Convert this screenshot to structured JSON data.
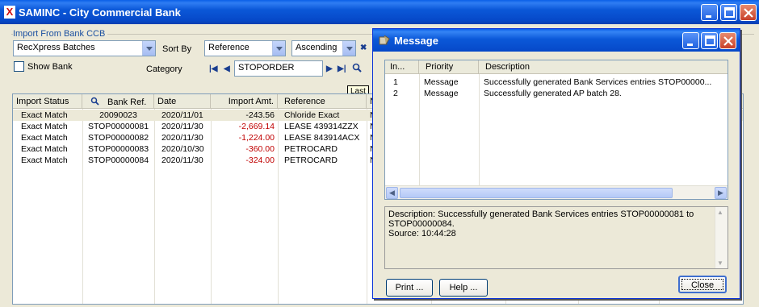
{
  "window": {
    "title": "SAMINC - City Commercial Bank"
  },
  "import_group": {
    "label": "Import From Bank CCB"
  },
  "source_combo": {
    "value": "RecXpress Batches"
  },
  "show_bank": {
    "label": "Show Bank"
  },
  "sort_by": {
    "label": "Sort By",
    "field": "Reference",
    "order": "Ascending"
  },
  "category": {
    "label": "Category",
    "value": "STOPORDER"
  },
  "tooltip": {
    "text": "Last"
  },
  "grid": {
    "columns": [
      "Import Status",
      "Bank Ref.",
      "Date",
      "Import Amt.",
      "Reference",
      "N"
    ],
    "rows": [
      {
        "status": "Exact Match",
        "bank_ref": "20090023",
        "date": "2020/11/01",
        "amount": "-243.56",
        "reference": "Chloride Exact",
        "n": "N"
      },
      {
        "status": "Exact Match",
        "bank_ref": "STOP00000081",
        "date": "2020/11/30",
        "amount": "-2,669.14",
        "reference": "LEASE 439314ZZX",
        "n": "N"
      },
      {
        "status": "Exact Match",
        "bank_ref": "STOP00000082",
        "date": "2020/11/30",
        "amount": "-1,224.00",
        "reference": "LEASE 843914ACX",
        "n": "N"
      },
      {
        "status": "Exact Match",
        "bank_ref": "STOP00000083",
        "date": "2020/10/30",
        "amount": "-360.00",
        "reference": "PETROCARD",
        "n": "N"
      },
      {
        "status": "Exact Match",
        "bank_ref": "STOP00000084",
        "date": "2020/11/30",
        "amount": "-324.00",
        "reference": "PETROCARD",
        "n": "N"
      }
    ]
  },
  "dialog": {
    "title": "Message",
    "columns": [
      "In...",
      "Priority",
      "Description"
    ],
    "rows": [
      {
        "index": "1",
        "priority": "Message",
        "description": "Successfully generated Bank Services entries STOP00000..."
      },
      {
        "index": "2",
        "priority": "Message",
        "description": "Successfully generated AP batch 28."
      }
    ],
    "detail_line1": "Description: Successfully generated Bank Services entries STOP00000081 to",
    "detail_line2": "STOP00000084.",
    "detail_line3": "Source:  10:44:28",
    "print_label": "Print ...",
    "help_label": "Help ...",
    "close_label": "Close"
  },
  "colors": {
    "titlebar": "#0a5fe8",
    "negative": "#c00000",
    "group_label": "#1a4fa0"
  }
}
